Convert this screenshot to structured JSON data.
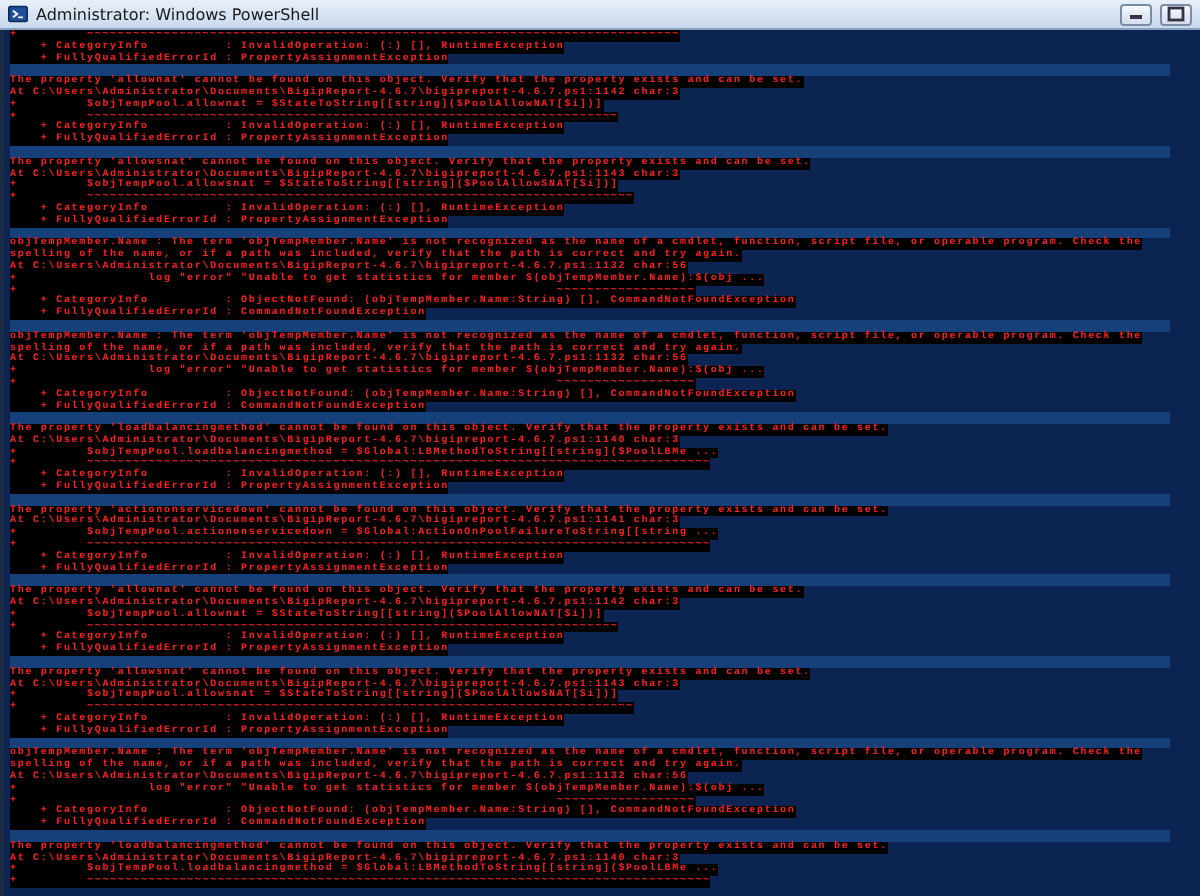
{
  "window": {
    "title": "Administrator: Windows PowerShell"
  },
  "console": {
    "lines": [
      {
        "kind": "error",
        "text": "+         ~~~~~~~~~~~~~~~~~~~~~~~~~~~~~~~~~~~~~~~~~~~~~~~~~~~~~~~~~~~~~~~~~~~~~~~~~~~~~"
      },
      {
        "kind": "error",
        "text": "    + CategoryInfo          : InvalidOperation: (:) [], RuntimeException"
      },
      {
        "kind": "error",
        "text": "    + FullyQualifiedErrorId : PropertyAssignmentException"
      },
      {
        "kind": "gap"
      },
      {
        "kind": "error",
        "text": "The property 'allownat' cannot be found on this object. Verify that the property exists and can be set."
      },
      {
        "kind": "error",
        "text": "At C:\\Users\\Administrator\\Documents\\BigipReport-4.6.7\\bigipreport-4.6.7.ps1:1142 char:3"
      },
      {
        "kind": "error",
        "text": "+         $objTempPool.allownat = $StateToString[[string]($PoolAllowNAT[$i])]"
      },
      {
        "kind": "error",
        "text": "+         ~~~~~~~~~~~~~~~~~~~~~~~~~~~~~~~~~~~~~~~~~~~~~~~~~~~~~~~~~~~~~~~~~~~~~"
      },
      {
        "kind": "error",
        "text": "    + CategoryInfo          : InvalidOperation: (:) [], RuntimeException"
      },
      {
        "kind": "error",
        "text": "    + FullyQualifiedErrorId : PropertyAssignmentException"
      },
      {
        "kind": "gap"
      },
      {
        "kind": "error",
        "text": "The property 'allowsnat' cannot be found on this object. Verify that the property exists and can be set."
      },
      {
        "kind": "error",
        "text": "At C:\\Users\\Administrator\\Documents\\BigipReport-4.6.7\\bigipreport-4.6.7.ps1:1143 char:3"
      },
      {
        "kind": "error",
        "text": "+         $objTempPool.allowsnat = $StateToString[[string]($PoolAllowSNAT[$i])]"
      },
      {
        "kind": "error",
        "text": "+         ~~~~~~~~~~~~~~~~~~~~~~~~~~~~~~~~~~~~~~~~~~~~~~~~~~~~~~~~~~~~~~~~~~~~~~~"
      },
      {
        "kind": "error",
        "text": "    + CategoryInfo          : InvalidOperation: (:) [], RuntimeException"
      },
      {
        "kind": "error",
        "text": "    + FullyQualifiedErrorId : PropertyAssignmentException"
      },
      {
        "kind": "gap"
      },
      {
        "kind": "error",
        "text": "objTempMember.Name : The term 'objTempMember.Name' is not recognized as the name of a cmdlet, function, script file, or operable program. Check the"
      },
      {
        "kind": "error",
        "text": "spelling of the name, or if a path was included, verify that the path is correct and try again."
      },
      {
        "kind": "error",
        "text": "At C:\\Users\\Administrator\\Documents\\BigipReport-4.6.7\\bigipreport-4.6.7.ps1:1132 char:56"
      },
      {
        "kind": "error",
        "text": "+                 log \"error\" \"Unable to get statistics for member $(objTempMember.Name):$(obj ..."
      },
      {
        "kind": "error",
        "text": "+                                                                      ~~~~~~~~~~~~~~~~~~"
      },
      {
        "kind": "error",
        "text": "    + CategoryInfo          : ObjectNotFound: (objTempMember.Name:String) [], CommandNotFoundException"
      },
      {
        "kind": "error",
        "text": "    + FullyQualifiedErrorId : CommandNotFoundException"
      },
      {
        "kind": "gap"
      },
      {
        "kind": "error",
        "text": "objTempMember.Name : The term 'objTempMember.Name' is not recognized as the name of a cmdlet, function, script file, or operable program. Check the"
      },
      {
        "kind": "error",
        "text": "spelling of the name, or if a path was included, verify that the path is correct and try again."
      },
      {
        "kind": "error",
        "text": "At C:\\Users\\Administrator\\Documents\\BigipReport-4.6.7\\bigipreport-4.6.7.ps1:1132 char:56"
      },
      {
        "kind": "error",
        "text": "+                 log \"error\" \"Unable to get statistics for member $(objTempMember.Name):$(obj ..."
      },
      {
        "kind": "error",
        "text": "+                                                                      ~~~~~~~~~~~~~~~~~~"
      },
      {
        "kind": "error",
        "text": "    + CategoryInfo          : ObjectNotFound: (objTempMember.Name:String) [], CommandNotFoundException"
      },
      {
        "kind": "error",
        "text": "    + FullyQualifiedErrorId : CommandNotFoundException"
      },
      {
        "kind": "gap"
      },
      {
        "kind": "error",
        "text": "The property 'loadbalancingmethod' cannot be found on this object. Verify that the property exists and can be set."
      },
      {
        "kind": "error",
        "text": "At C:\\Users\\Administrator\\Documents\\BigipReport-4.6.7\\bigipreport-4.6.7.ps1:1140 char:3"
      },
      {
        "kind": "error",
        "text": "+         $objTempPool.loadbalancingmethod = $Global:LBMethodToString[[string]($PoolLBMe ..."
      },
      {
        "kind": "error",
        "text": "+         ~~~~~~~~~~~~~~~~~~~~~~~~~~~~~~~~~~~~~~~~~~~~~~~~~~~~~~~~~~~~~~~~~~~~~~~~~~~~~~~~~"
      },
      {
        "kind": "error",
        "text": "    + CategoryInfo          : InvalidOperation: (:) [], RuntimeException"
      },
      {
        "kind": "error",
        "text": "    + FullyQualifiedErrorId : PropertyAssignmentException"
      },
      {
        "kind": "gap"
      },
      {
        "kind": "error",
        "text": "The property 'actiononservicedown' cannot be found on this object. Verify that the property exists and can be set."
      },
      {
        "kind": "error",
        "text": "At C:\\Users\\Administrator\\Documents\\BigipReport-4.6.7\\bigipreport-4.6.7.ps1:1141 char:3"
      },
      {
        "kind": "error",
        "text": "+         $objTempPool.actiononservicedown = $Global:ActionOnPoolFailureToString[[string ..."
      },
      {
        "kind": "error",
        "text": "+         ~~~~~~~~~~~~~~~~~~~~~~~~~~~~~~~~~~~~~~~~~~~~~~~~~~~~~~~~~~~~~~~~~~~~~~~~~~~~~~~~~"
      },
      {
        "kind": "error",
        "text": "    + CategoryInfo          : InvalidOperation: (:) [], RuntimeException"
      },
      {
        "kind": "error",
        "text": "    + FullyQualifiedErrorId : PropertyAssignmentException"
      },
      {
        "kind": "gap"
      },
      {
        "kind": "error",
        "text": "The property 'allownat' cannot be found on this object. Verify that the property exists and can be set."
      },
      {
        "kind": "error",
        "text": "At C:\\Users\\Administrator\\Documents\\BigipReport-4.6.7\\bigipreport-4.6.7.ps1:1142 char:3"
      },
      {
        "kind": "error",
        "text": "+         $objTempPool.allownat = $StateToString[[string]($PoolAllowNAT[$i])]"
      },
      {
        "kind": "error",
        "text": "+         ~~~~~~~~~~~~~~~~~~~~~~~~~~~~~~~~~~~~~~~~~~~~~~~~~~~~~~~~~~~~~~~~~~~~~"
      },
      {
        "kind": "error",
        "text": "    + CategoryInfo          : InvalidOperation: (:) [], RuntimeException"
      },
      {
        "kind": "error",
        "text": "    + FullyQualifiedErrorId : PropertyAssignmentException"
      },
      {
        "kind": "gap"
      },
      {
        "kind": "error",
        "text": "The property 'allowsnat' cannot be found on this object. Verify that the property exists and can be set."
      },
      {
        "kind": "error",
        "text": "At C:\\Users\\Administrator\\Documents\\BigipReport-4.6.7\\bigipreport-4.6.7.ps1:1143 char:3"
      },
      {
        "kind": "error",
        "text": "+         $objTempPool.allowsnat = $StateToString[[string]($PoolAllowSNAT[$i])]"
      },
      {
        "kind": "error",
        "text": "+         ~~~~~~~~~~~~~~~~~~~~~~~~~~~~~~~~~~~~~~~~~~~~~~~~~~~~~~~~~~~~~~~~~~~~~~~"
      },
      {
        "kind": "error",
        "text": "    + CategoryInfo          : InvalidOperation: (:) [], RuntimeException"
      },
      {
        "kind": "error",
        "text": "    + FullyQualifiedErrorId : PropertyAssignmentException"
      },
      {
        "kind": "gap"
      },
      {
        "kind": "error",
        "text": "objTempMember.Name : The term 'objTempMember.Name' is not recognized as the name of a cmdlet, function, script file, or operable program. Check the"
      },
      {
        "kind": "error",
        "text": "spelling of the name, or if a path was included, verify that the path is correct and try again."
      },
      {
        "kind": "error",
        "text": "At C:\\Users\\Administrator\\Documents\\BigipReport-4.6.7\\bigipreport-4.6.7.ps1:1132 char:56"
      },
      {
        "kind": "error",
        "text": "+                 log \"error\" \"Unable to get statistics for member $(objTempMember.Name):$(obj ..."
      },
      {
        "kind": "error",
        "text": "+                                                                      ~~~~~~~~~~~~~~~~~~"
      },
      {
        "kind": "error",
        "text": "    + CategoryInfo          : ObjectNotFound: (objTempMember.Name:String) [], CommandNotFoundException"
      },
      {
        "kind": "error",
        "text": "    + FullyQualifiedErrorId : CommandNotFoundException"
      },
      {
        "kind": "gap"
      },
      {
        "kind": "error",
        "text": "The property 'loadbalancingmethod' cannot be found on this object. Verify that the property exists and can be set."
      },
      {
        "kind": "error",
        "text": "At C:\\Users\\Administrator\\Documents\\BigipReport-4.6.7\\bigipreport-4.6.7.ps1:1140 char:3"
      },
      {
        "kind": "error",
        "text": "+         $objTempPool.loadbalancingmethod = $Global:LBMethodToString[[string]($PoolLBMe ..."
      },
      {
        "kind": "error",
        "text": "+         ~~~~~~~~~~~~~~~~~~~~~~~~~~~~~~~~~~~~~~~~~~~~~~~~~~~~~~~~~~~~~~~~~~~~~~~~~~~~~~~~~"
      }
    ]
  }
}
